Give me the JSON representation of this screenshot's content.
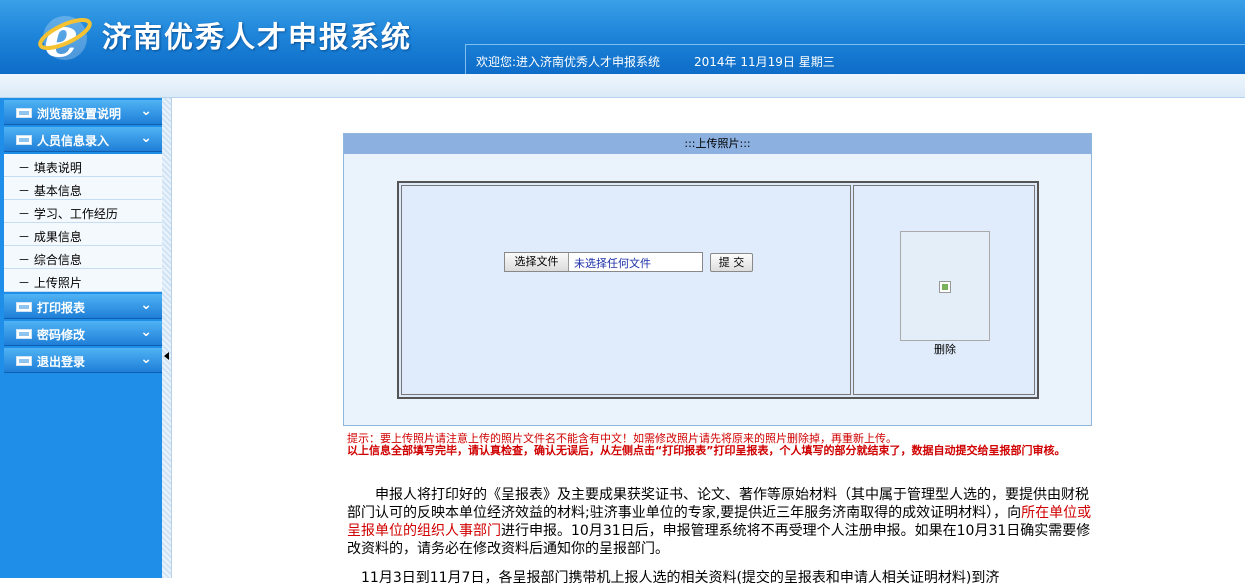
{
  "header": {
    "title": "济南优秀人才申报系统",
    "welcome": "欢迎您:进入济南优秀人才申报系统",
    "date": "2014年 11月19日 星期三"
  },
  "sidebar": {
    "groups": [
      {
        "label": "浏览器设置说明",
        "items": []
      },
      {
        "label": "人员信息录入",
        "items": [
          "－ 填表说明",
          "－ 基本信息",
          "－ 学习、工作经历",
          "－ 成果信息",
          "－ 综合信息",
          "－ 上传照片"
        ]
      },
      {
        "label": "打印报表",
        "items": []
      },
      {
        "label": "密码修改",
        "items": []
      },
      {
        "label": "退出登录",
        "items": []
      }
    ]
  },
  "upload": {
    "panel_title": ":::上传照片:::",
    "choose_file": "选择文件",
    "no_file": "未选择任何文件",
    "submit": "提 交",
    "delete": "删除"
  },
  "notes": {
    "tip1": "提示：要上传照片请注意上传的照片文件名不能含有中文！如需修改照片请先将原来的照片删除掉，再重新上传。",
    "tip2": "以上信息全部填写完毕，请认真检查，确认无误后，从左侧点击“打印报表”打印呈报表，个人填写的部分就结束了，数据自动提交给呈报部门审核。",
    "para_a": "申报人将打印好的《呈报表》及主要成果获奖证书、论文、著作等原始材料（其中属于管理型人选的，要提供由财税部门认可的反映本单位经济效益的材料;驻济事业单位的专家,要提供近三年服务济南取得的成效证明材料），向",
    "para_red": "所在单位或呈报单位的组织人事部门",
    "para_b": "进行申报。10月31日后，申报管理系统将不再受理个人注册申报。如果在10月31日确实需要修改资料的，请务必在修改资料后通知你的呈报部门。",
    "para2": "11月3日到11月7日，各呈报部门携带机上报人选的相关资料(提交的呈报表和申请人相关证明材料)到济"
  },
  "colors": {
    "accent": "#1f86da",
    "warning": "#d00000"
  },
  "icons": {
    "logo": "ie-logo-icon",
    "chevron": "double-chevron-down-icon",
    "collapse": "collapse-left-icon"
  }
}
